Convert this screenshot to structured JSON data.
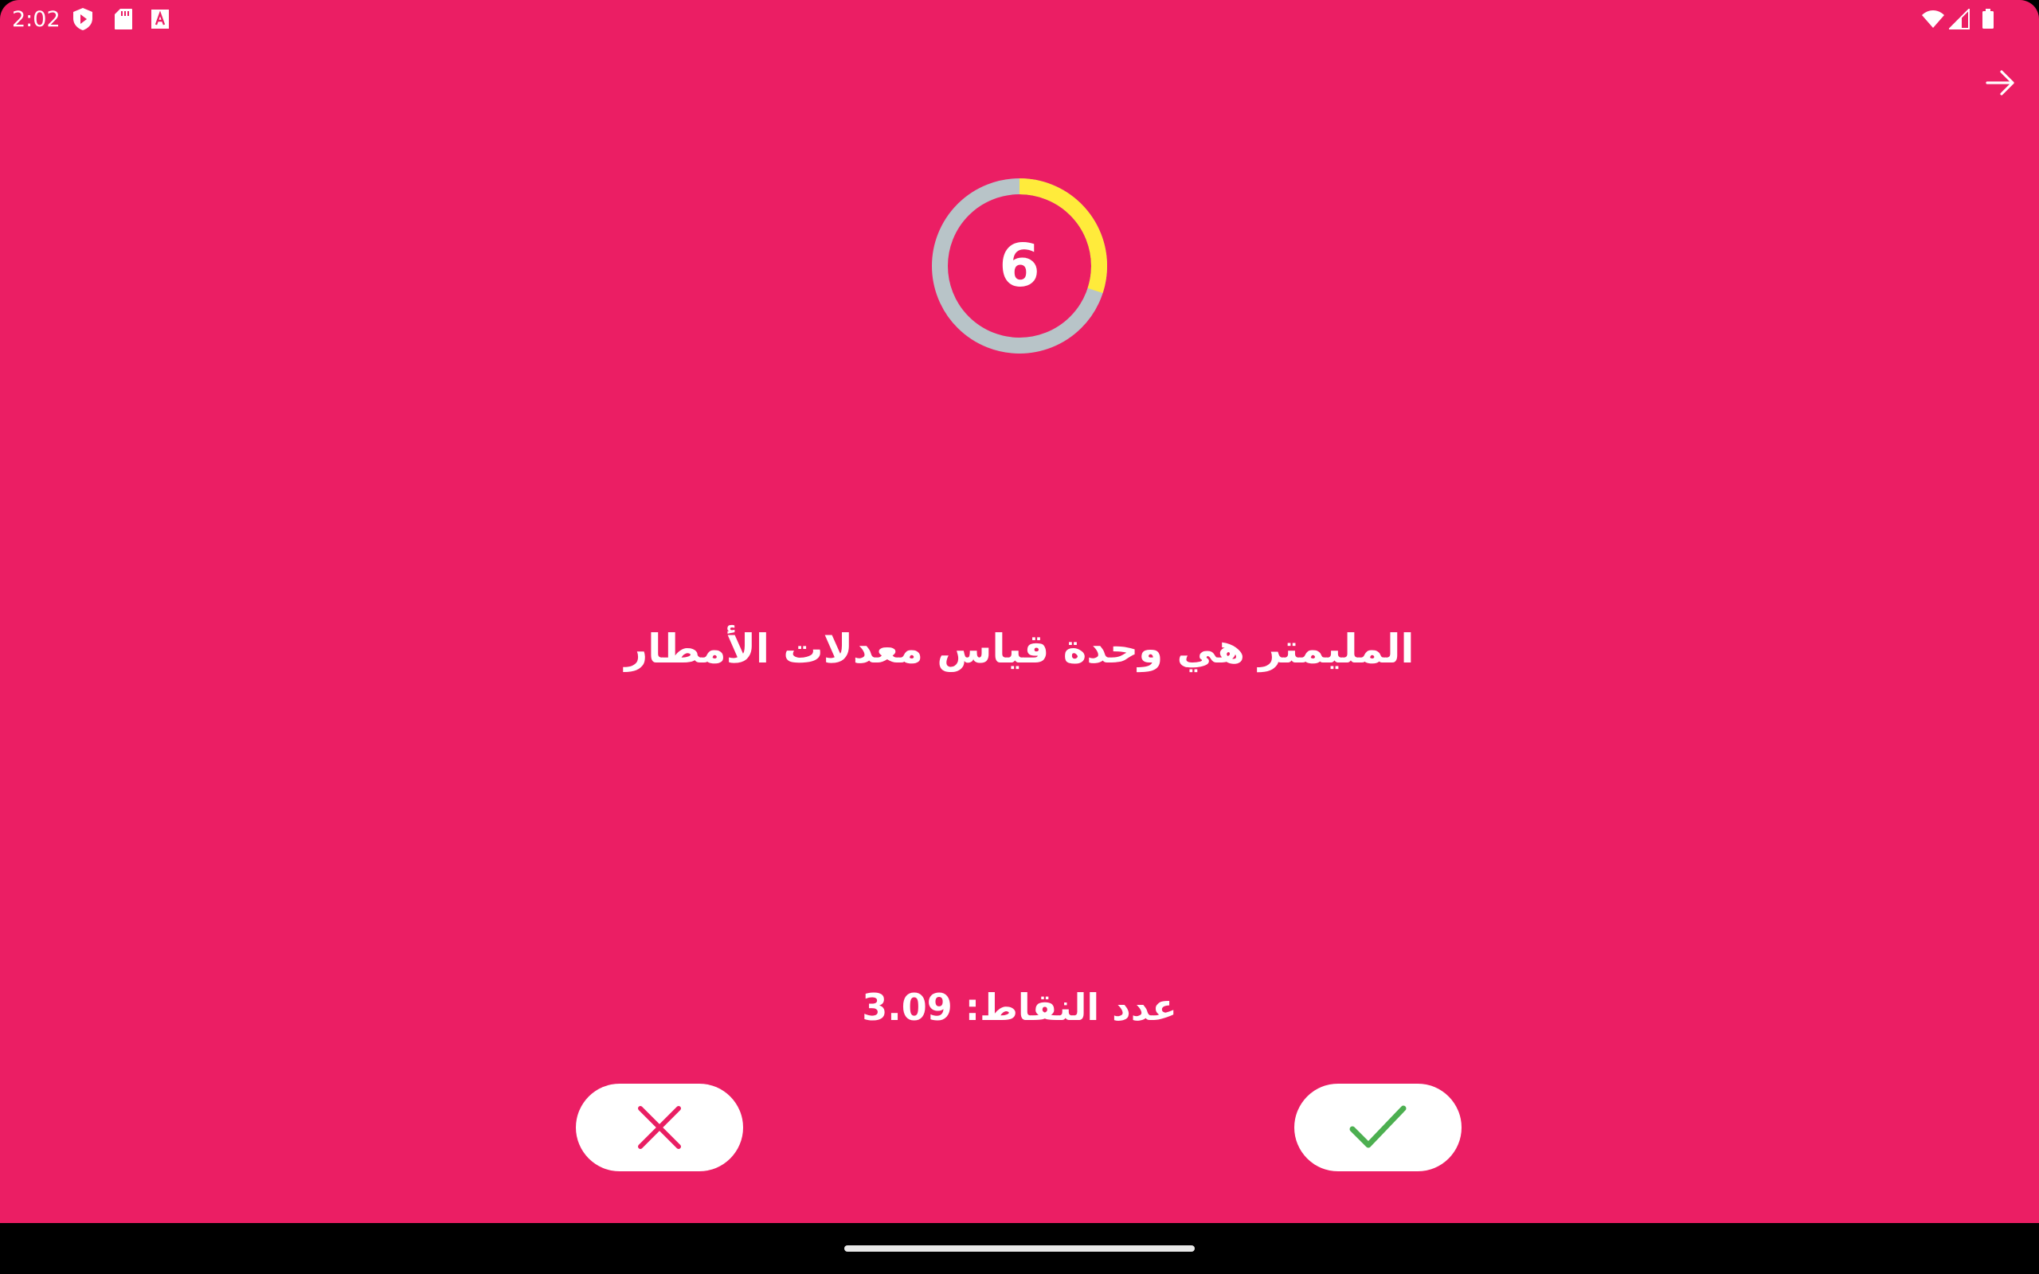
{
  "status_bar": {
    "time": "2:02",
    "left_icons": [
      "shield-play-icon",
      "sd-card-icon",
      "font-a-icon"
    ],
    "right_icons": [
      "wifi-icon",
      "cell-signal-icon",
      "battery-icon"
    ]
  },
  "top_bar": {
    "forward_icon": "arrow-right-icon"
  },
  "timer": {
    "value": "6",
    "progress_fraction": 0.3,
    "ring_color": "#B8C4C8",
    "progress_color": "#FFEB3B"
  },
  "question": {
    "text": "المليمتر هي وحدة قياس معدلات الأمطار"
  },
  "score": {
    "label": "عدد النقاط:",
    "value": "3.09"
  },
  "answers": {
    "wrong_icon": "close-icon",
    "right_icon": "check-icon"
  },
  "colors": {
    "background": "#EB1E64",
    "wrong": "#E91E63",
    "right": "#4CAF50"
  }
}
